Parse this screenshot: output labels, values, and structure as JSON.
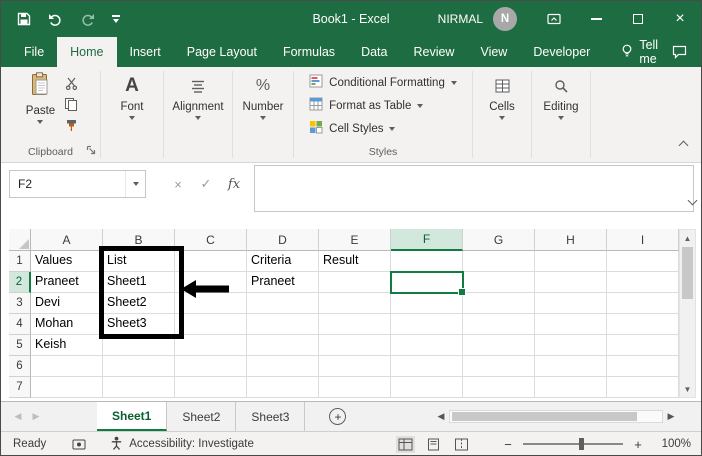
{
  "title_bar": {
    "title": "Book1 - Excel",
    "user_name": "NIRMAL",
    "avatar_initial": "N"
  },
  "ribbon_tabs": {
    "items": [
      "File",
      "Home",
      "Insert",
      "Page Layout",
      "Formulas",
      "Data",
      "Review",
      "View",
      "Developer"
    ],
    "selected": "Home",
    "tell_me_label": "Tell me"
  },
  "ribbon": {
    "paste_label": "Paste",
    "font_label": "Font",
    "alignment_label": "Alignment",
    "number_label": "Number",
    "styles_buttons": [
      "Conditional Formatting",
      "Format as Table",
      "Cell Styles"
    ],
    "cells_label": "Cells",
    "editing_label": "Editing",
    "group_labels": {
      "clipboard": "Clipboard",
      "styles": "Styles"
    }
  },
  "formula_bar": {
    "name_box_value": "F2",
    "fx_label": "fx",
    "formula_value": ""
  },
  "sheet": {
    "selected_cell": "F2",
    "columns": [
      "A",
      "B",
      "C",
      "D",
      "E",
      "F",
      "G",
      "H",
      "I"
    ],
    "row_numbers": [
      "1",
      "2",
      "3",
      "4",
      "5",
      "6",
      "7"
    ],
    "cells": [
      [
        "Values",
        "List",
        "",
        "Criteria",
        "Result",
        "",
        "",
        "",
        ""
      ],
      [
        "Praneet",
        "Sheet1",
        "",
        "Praneet",
        "",
        "",
        "",
        "",
        ""
      ],
      [
        "Devi",
        "Sheet2",
        "",
        "",
        "",
        "",
        "",
        "",
        ""
      ],
      [
        "Mohan",
        "Sheet3",
        "",
        "",
        "",
        "",
        "",
        "",
        ""
      ],
      [
        "Keish",
        "",
        "",
        "",
        "",
        "",
        "",
        "",
        ""
      ],
      [
        "",
        "",
        "",
        "",
        "",
        "",
        "",
        "",
        ""
      ],
      [
        "",
        "",
        "",
        "",
        "",
        "",
        "",
        "",
        ""
      ]
    ]
  },
  "sheet_tabs": {
    "items": [
      "Sheet1",
      "Sheet2",
      "Sheet3"
    ],
    "active": "Sheet1"
  },
  "status_bar": {
    "mode": "Ready",
    "accessibility_label": "Accessibility: Investigate",
    "zoom_percent": "100%"
  },
  "icons": {
    "scroll_up": "▲",
    "scroll_down": "▼",
    "scroll_left": "◀",
    "scroll_right": "▶",
    "add_sheet": "+",
    "zoom_out": "−",
    "zoom_in": "+",
    "close": "×",
    "cancel": "×",
    "enter_check": "✓",
    "big_a": "A",
    "percent": "%"
  },
  "colors": {
    "title_green": "#1E6C41",
    "accent_green": "#107C41",
    "selected_header_fill": "#D2E8DC",
    "annotation": "#000000"
  }
}
